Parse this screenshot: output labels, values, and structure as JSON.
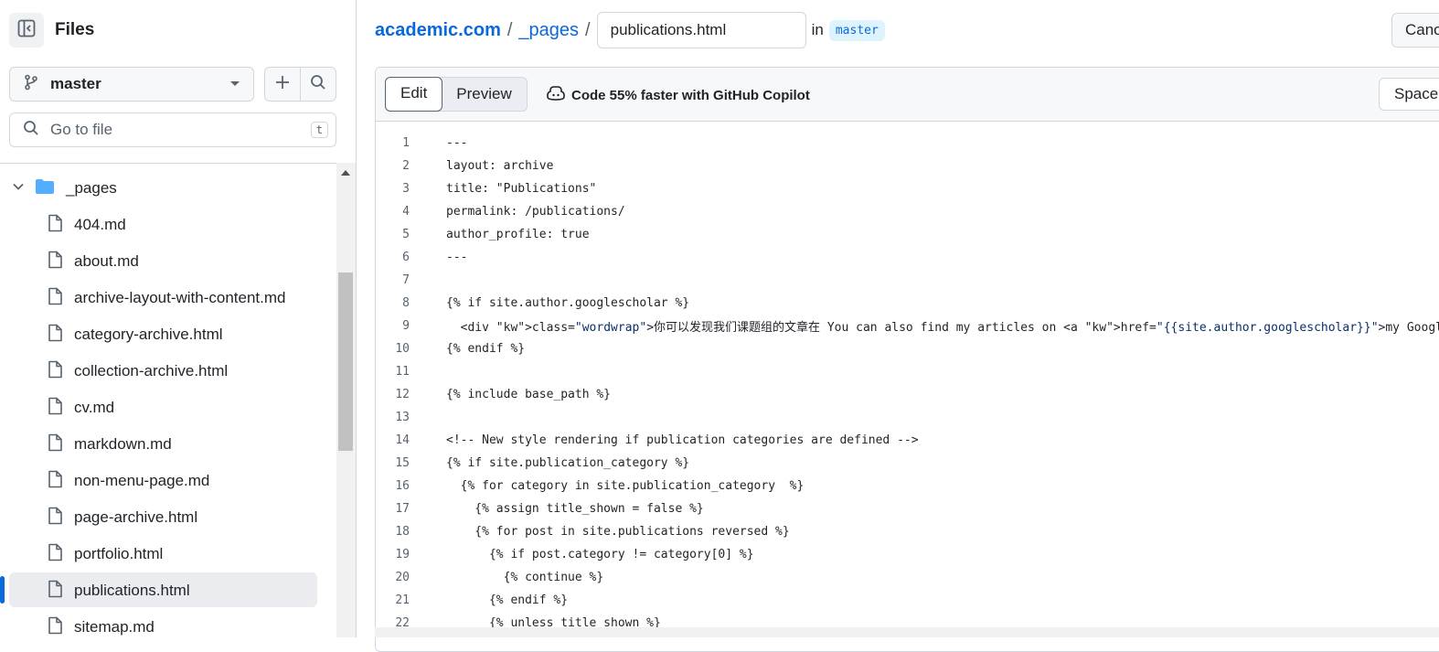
{
  "sidebar": {
    "title": "Files",
    "branch": "master",
    "goto_placeholder": "Go to file",
    "goto_shortcut": "t",
    "folder": "_pages",
    "files": [
      "404.md",
      "about.md",
      "archive-layout-with-content.md",
      "category-archive.html",
      "collection-archive.html",
      "cv.md",
      "markdown.md",
      "non-menu-page.md",
      "page-archive.html",
      "portfolio.html",
      "publications.html",
      "sitemap.md"
    ],
    "selected_file": "publications.html"
  },
  "header": {
    "repo": "academic.com",
    "sep1": "/",
    "folder": "_pages",
    "sep2": "/",
    "filename": "publications.html",
    "in_text": "in",
    "branch_pill": "master",
    "cancel_label": "Cancel changes"
  },
  "editor": {
    "tabs": [
      "Edit",
      "Preview"
    ],
    "active_tab": "Edit",
    "copilot_text": "Code 55% faster with GitHub Copilot",
    "spaces_label": "Spaces",
    "lines": [
      "---",
      "layout: archive",
      "title: \"Publications\"",
      "permalink: /publications/",
      "author_profile: true",
      "---",
      "",
      "{% if site.author.googlescholar %}",
      "  <div class=\"wordwrap\">你可以发现我们课题组的文章在 You can also find my articles on <a href=\"{{site.author.googlescholar}}\">my Google Scholar profile</a>.</div>",
      "{% endif %}",
      "",
      "{% include base_path %}",
      "",
      "<!-- New style rendering if publication categories are defined -->",
      "{% if site.publication_category %}",
      "  {% for category in site.publication_category  %}",
      "    {% assign title_shown = false %}",
      "    {% for post in site.publications reversed %}",
      "      {% if post.category != category[0] %}",
      "        {% continue %}",
      "      {% endif %}",
      "      {% unless title_shown %}"
    ]
  },
  "colors": {
    "accent": "#0969da",
    "border": "#d0d7de",
    "selected_bg": "#eaecef",
    "pill_bg": "#ddf4ff"
  }
}
